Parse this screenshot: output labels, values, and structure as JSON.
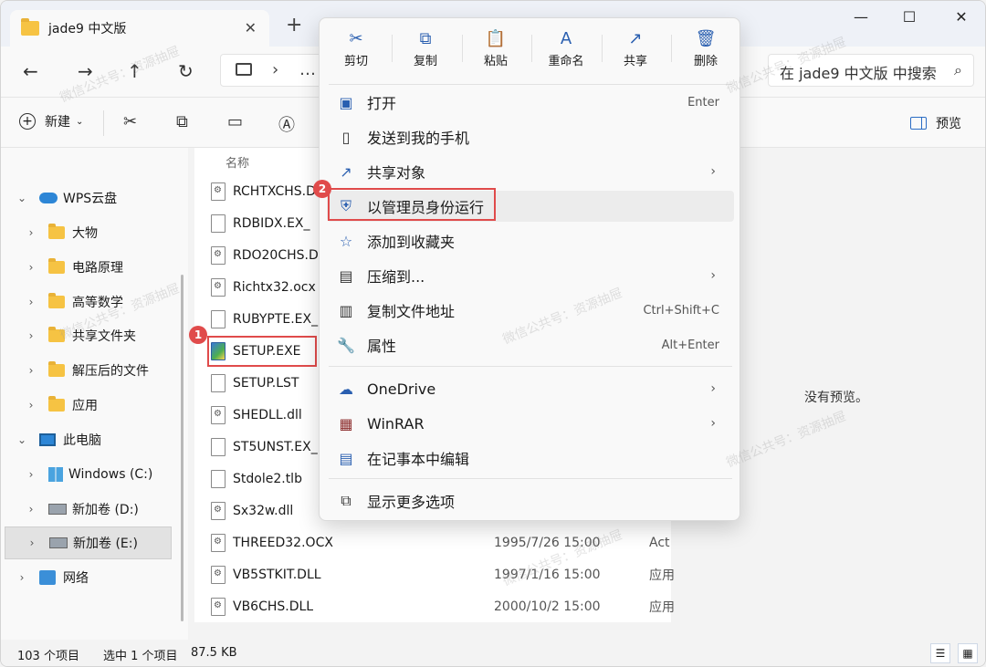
{
  "tab": {
    "title": "jade9 中文版",
    "close": "✕",
    "new": "+"
  },
  "window": {
    "minimize": "—",
    "maximize": "☐",
    "close": "✕"
  },
  "nav": {
    "back": "←",
    "forward": "→",
    "up": "↑",
    "refresh": "↻",
    "chevron": "›",
    "more": "…",
    "search_placeholder": "在 jade9 中文版 中搜索"
  },
  "cmd": {
    "new_label": "新建",
    "preview_label": "预览"
  },
  "sidebar": {
    "items": [
      {
        "label": "WPS云盘"
      },
      {
        "label": "大物"
      },
      {
        "label": "电路原理"
      },
      {
        "label": "高等数学"
      },
      {
        "label": "共享文件夹"
      },
      {
        "label": "解压后的文件"
      },
      {
        "label": "应用"
      },
      {
        "label": "此电脑"
      },
      {
        "label": "Windows (C:)"
      },
      {
        "label": "新加卷 (D:)"
      },
      {
        "label": "新加卷 (E:)"
      },
      {
        "label": "网络"
      }
    ]
  },
  "files": {
    "header": "名称",
    "rows": [
      {
        "name": "RCHTXCHS.DLL",
        "date": "",
        "type": ""
      },
      {
        "name": "RDBIDX.EX_",
        "date": "",
        "type": ""
      },
      {
        "name": "RDO20CHS.DLL",
        "date": "",
        "type": ""
      },
      {
        "name": "Richtx32.ocx",
        "date": "",
        "type": ""
      },
      {
        "name": "RUBYPTE.EX_",
        "date": "",
        "type": ""
      },
      {
        "name": "SETUP.EXE",
        "date": "",
        "type": ""
      },
      {
        "name": "SETUP.LST",
        "date": "",
        "type": ""
      },
      {
        "name": "SHEDLL.dll",
        "date": "",
        "type": ""
      },
      {
        "name": "ST5UNST.EX_",
        "date": "",
        "type": ""
      },
      {
        "name": "Stdole2.tlb",
        "date": "",
        "type": ""
      },
      {
        "name": "Sx32w.dll",
        "date": "",
        "type": ""
      },
      {
        "name": "THREED32.OCX",
        "date": "1995/7/26 15:00",
        "type": "Act"
      },
      {
        "name": "VB5STKIT.DLL",
        "date": "1997/1/16 15:00",
        "type": "应用"
      },
      {
        "name": "VB6CHS.DLL",
        "date": "2000/10/2 15:00",
        "type": "应用"
      }
    ]
  },
  "preview": {
    "empty_text": "没有预览。"
  },
  "status": {
    "count": "103 个项目",
    "selected": "选中 1 个项目",
    "size": "87.5 KB"
  },
  "badges": {
    "one": "1",
    "two": "2"
  },
  "menu": {
    "top": [
      {
        "label": "剪切",
        "icon": "✂"
      },
      {
        "label": "复制",
        "icon": "⧉"
      },
      {
        "label": "粘贴",
        "icon": "📋"
      },
      {
        "label": "重命名",
        "icon": "A"
      },
      {
        "label": "共享",
        "icon": "↗"
      },
      {
        "label": "删除",
        "icon": "🗑"
      }
    ],
    "items": [
      {
        "label": "打开",
        "key": "Enter"
      },
      {
        "label": "发送到我的手机",
        "key": ""
      },
      {
        "label": "共享对象",
        "key": ""
      },
      {
        "label": "以管理员身份运行",
        "key": ""
      },
      {
        "label": "添加到收藏夹",
        "key": ""
      },
      {
        "label": "压缩到...",
        "key": ""
      },
      {
        "label": "复制文件地址",
        "key": "Ctrl+Shift+C"
      },
      {
        "label": "属性",
        "key": "Alt+Enter"
      },
      {
        "label": "OneDrive",
        "key": ""
      },
      {
        "label": "WinRAR",
        "key": ""
      },
      {
        "label": "在记事本中编辑",
        "key": ""
      },
      {
        "label": "显示更多选项",
        "key": ""
      }
    ]
  },
  "watermark": "微信公共号：资源抽屉",
  "colors": {
    "accent": "#2a5fb0",
    "highlight": "#e04b4b"
  }
}
